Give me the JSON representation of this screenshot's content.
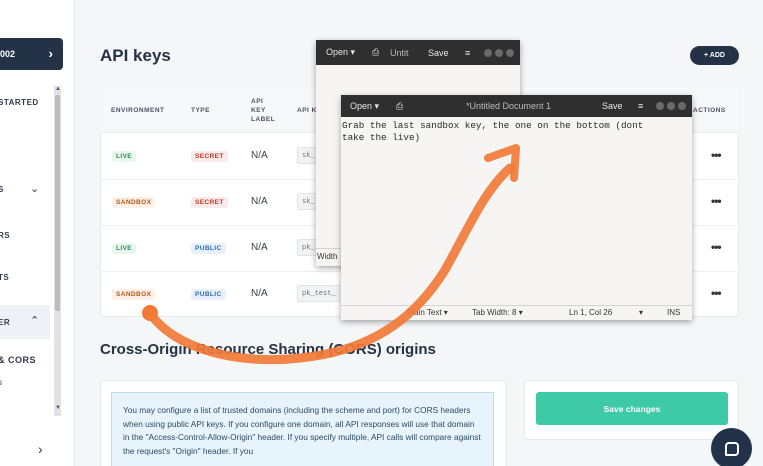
{
  "sidebar": {
    "org_label": "002",
    "items": [
      {
        "label": "STARTED"
      },
      {
        "label": "S"
      },
      {
        "label": "RS"
      },
      {
        "label": "TS"
      },
      {
        "label": "ER"
      },
      {
        "label": "& CORS"
      },
      {
        "label": "s"
      }
    ]
  },
  "api_keys": {
    "title": "API keys",
    "add_label": "+ ADD",
    "columns": [
      "ENVIRONMENT",
      "TYPE",
      "API KEY LABEL",
      "API K",
      "ACTIONS"
    ],
    "rows": [
      {
        "environment": "LIVE",
        "type": "SECRET",
        "label": "N/A",
        "key": "sk_"
      },
      {
        "environment": "SANDBOX",
        "type": "SECRET",
        "label": "N/A",
        "key": "sk_"
      },
      {
        "environment": "LIVE",
        "type": "PUBLIC",
        "label": "N/A",
        "key": "pk_"
      },
      {
        "environment": "SANDBOX",
        "type": "PUBLIC",
        "label": "N/A",
        "key": "pk_test_"
      }
    ],
    "actions_glyph": "•••"
  },
  "cors": {
    "title": "Cross-Origin Resource Sharing (CORS) origins",
    "info_text": "You may configure a list of trusted domains (including the scheme and port) for CORS headers when using public API keys. If you configure one domain, all API responses will use that domain in the \"Access-Control-Allow-Origin\" header. If you specify multiple, API calls will compare against the request's \"Origin\" header. If you",
    "save_label": "Save changes"
  },
  "gedit_back": {
    "open_label": "Open ▾",
    "title": "Untit",
    "save_label": "Save",
    "status_width": "Width"
  },
  "gedit_front": {
    "open_label": "Open ▾",
    "title": "*Untitled Document 1",
    "save_label": "Save",
    "menu_glyph": "≡",
    "content": "Grab the last sandbox key, the one on the bottom (dont\ntake the live)",
    "status": {
      "syntax": "Plain Text ▾",
      "tab_width": "Tab Width: 8 ▾",
      "position": "Ln 1, Col 26",
      "mode": "INS"
    }
  },
  "annotation": {
    "color": "#f07a36"
  },
  "colors": {
    "brand_dark": "#233247",
    "save_green": "#3ec9a7"
  }
}
